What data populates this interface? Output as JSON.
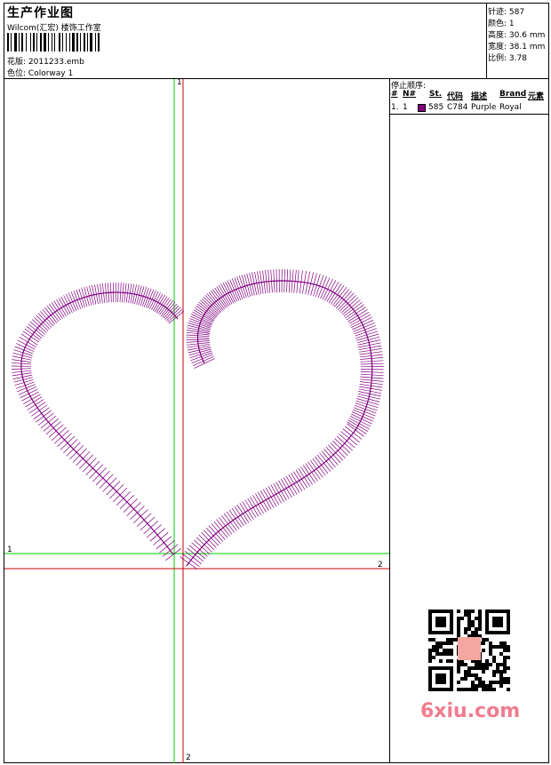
{
  "header": {
    "title": "生产作业图",
    "company": "Wilcom(汇宏) 楼饰工作室",
    "design_label": "花版:",
    "design_value": "2011233.emb",
    "colorway_label": "色位:",
    "colorway_value": "Colorway 1"
  },
  "stats": [
    {
      "label": "针迹:",
      "value": "587"
    },
    {
      "label": "颜色:",
      "value": "1"
    },
    {
      "label": "高度:",
      "value": "30.6 mm"
    },
    {
      "label": "宽度:",
      "value": "38.1 mm"
    },
    {
      "label": "比例:",
      "value": "3.78"
    }
  ],
  "stops": {
    "title": "停止顺序:",
    "headers": {
      "num": "#",
      "n": "N#",
      "st": "St.",
      "code": "代码",
      "desc": "描述",
      "brand": "Brand",
      "elem": "元素"
    },
    "rows": [
      {
        "num": "1.",
        "n": "1",
        "st": "585",
        "code": "C784",
        "desc": "Purple",
        "brand": "Royal",
        "color": "#800080"
      }
    ]
  },
  "axes": {
    "green_v": "1",
    "green_h": "1",
    "red_h": "2",
    "red_v": "2"
  },
  "colors": {
    "thread": "#800080",
    "green": "#00cc00",
    "red": "#cc0000",
    "watermark": "#f17c8f"
  },
  "watermark": "6xiu.com"
}
